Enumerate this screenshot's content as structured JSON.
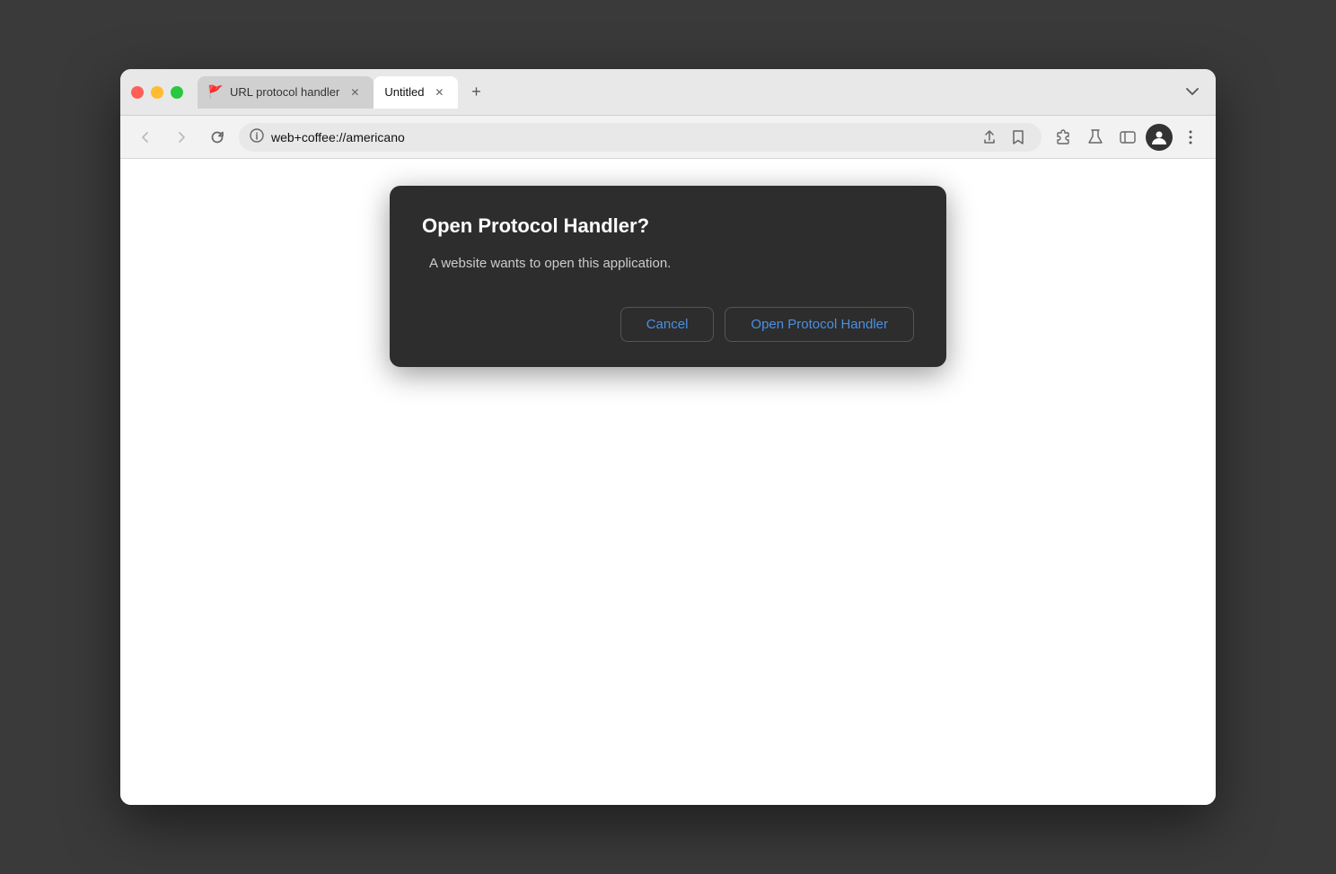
{
  "browser": {
    "tabs": [
      {
        "id": "tab1",
        "label": "URL protocol handler",
        "active": false,
        "favicon": "🚩"
      },
      {
        "id": "tab2",
        "label": "Untitled",
        "active": true,
        "favicon": null
      }
    ],
    "new_tab_label": "+",
    "tab_dropdown_label": "⌄",
    "nav": {
      "back_label": "‹",
      "forward_label": "›",
      "reload_label": "↻",
      "url": "web+coffee://americano",
      "share_label": "⬆",
      "bookmark_label": "☆"
    },
    "toolbar": {
      "extensions_label": "🧩",
      "lab_label": "🧪",
      "sidebar_label": "▭",
      "profile_label": "👤",
      "more_label": "⋮"
    }
  },
  "dialog": {
    "title": "Open Protocol Handler?",
    "message": "A website wants to open this application.",
    "cancel_label": "Cancel",
    "confirm_label": "Open Protocol Handler"
  }
}
